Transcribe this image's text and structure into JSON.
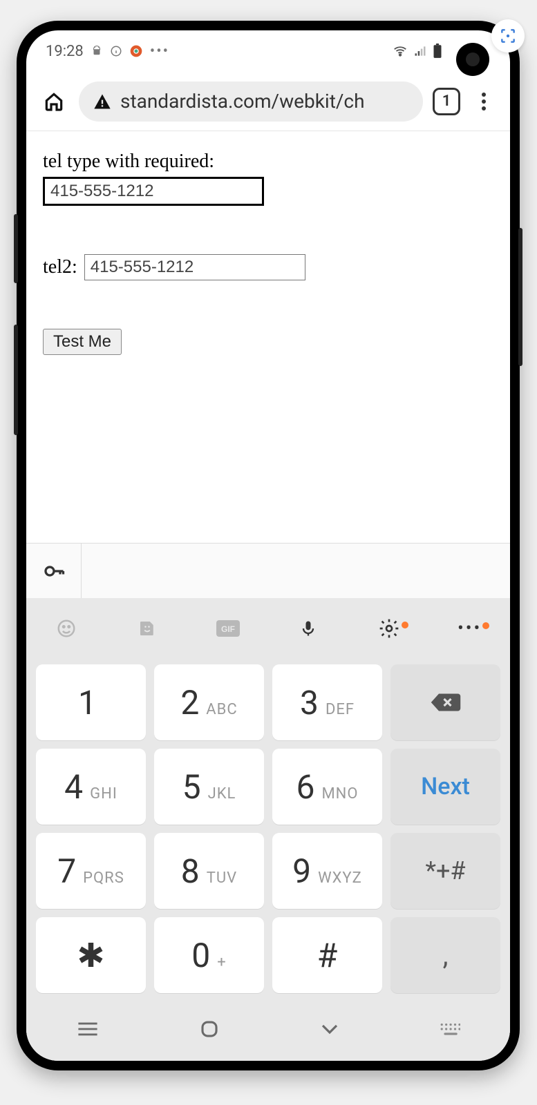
{
  "status": {
    "time": "19:28",
    "icons_left": [
      "android-icon",
      "info-icon",
      "chrome-icon",
      "more-icon"
    ],
    "icons_right": [
      "wifi-icon",
      "signal-icon",
      "battery-icon"
    ]
  },
  "browser": {
    "url": "standardista.com/webkit/ch",
    "tab_count": "1"
  },
  "page": {
    "label1": "tel type with required:",
    "input1_value": "415-555-1212",
    "label2": "tel2:",
    "input2_value": "415-555-1212",
    "button_label": "Test Me"
  },
  "keyboard": {
    "toolbar": [
      "emoji-icon",
      "sticker-icon",
      "gif-icon",
      "mic-icon",
      "gear-icon",
      "more-icon"
    ],
    "next_label": "Next",
    "keys": [
      {
        "d": "1",
        "s": ""
      },
      {
        "d": "2",
        "s": "ABC"
      },
      {
        "d": "3",
        "s": "DEF"
      },
      {
        "d": "4",
        "s": "GHI"
      },
      {
        "d": "5",
        "s": "JKL"
      },
      {
        "d": "6",
        "s": "MNO"
      },
      {
        "d": "7",
        "s": "PQRS"
      },
      {
        "d": "8",
        "s": "TUV"
      },
      {
        "d": "9",
        "s": "WXYZ"
      },
      {
        "d": "✱",
        "s": ""
      },
      {
        "d": "0",
        "s": "+"
      },
      {
        "d": "#",
        "s": ""
      }
    ],
    "sym_key": "*+#",
    "comma_key": ","
  }
}
